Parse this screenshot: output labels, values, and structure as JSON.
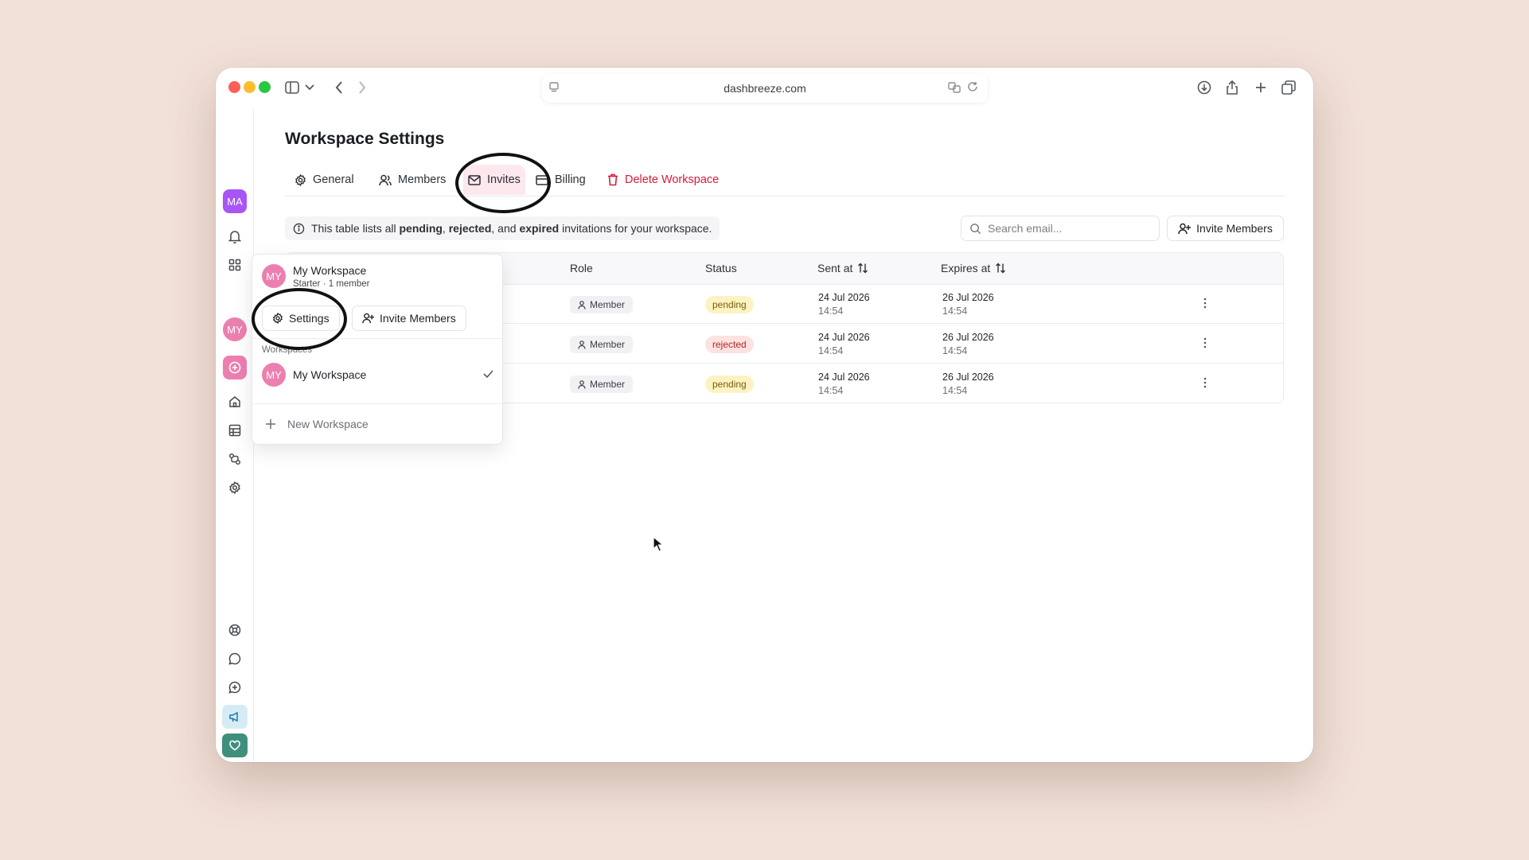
{
  "browser": {
    "url": "dashbreeze.com"
  },
  "rail": {
    "user_initials": "MA",
    "workspace_initials": "MY"
  },
  "page": {
    "title": "Workspace Settings"
  },
  "tabs": [
    {
      "label": "General",
      "icon": "gear-icon"
    },
    {
      "label": "Members",
      "icon": "users-icon"
    },
    {
      "label": "Invites",
      "icon": "mail-icon"
    },
    {
      "label": "Billing",
      "icon": "card-icon"
    },
    {
      "label": "Delete Workspace",
      "icon": "trash-icon"
    }
  ],
  "info": {
    "prefix": "This table lists all ",
    "pending": "pending",
    "sep1": ", ",
    "rejected": "rejected",
    "sep2": ", and ",
    "expired": "expired",
    "suffix": " invitations for your workspace."
  },
  "search": {
    "placeholder": "Search email..."
  },
  "invite_button": "Invite Members",
  "table": {
    "columns": {
      "role": "Role",
      "status": "Status",
      "sent": "Sent at",
      "expires": "Expires at"
    },
    "rows": [
      {
        "role": "Member",
        "status": "pending",
        "sent_date": "24 Jul 2026",
        "sent_time": "14:54",
        "exp_date": "26 Jul 2026",
        "exp_time": "14:54"
      },
      {
        "role": "Member",
        "status": "rejected",
        "sent_date": "24 Jul 2026",
        "sent_time": "14:54",
        "exp_date": "26 Jul 2026",
        "exp_time": "14:54"
      },
      {
        "role": "Member",
        "status": "pending",
        "sent_date": "24 Jul 2026",
        "sent_time": "14:54",
        "exp_date": "26 Jul 2026",
        "exp_time": "14:54"
      }
    ]
  },
  "dropdown": {
    "workspace_initials": "MY",
    "workspace_name": "My Workspace",
    "workspace_plan": "Starter · 1 member",
    "settings_button": "Settings",
    "invite_button": "Invite Members",
    "section_label": "Workspaces",
    "items": [
      {
        "initials": "MY",
        "name": "My Workspace"
      }
    ],
    "new_workspace": "New Workspace"
  },
  "colors": {
    "accent_danger": "#d21d3a",
    "active_tab_bg": "#fde8ee",
    "user_avatar": "#a855f7",
    "workspace_avatar": "#ec7fb0"
  }
}
